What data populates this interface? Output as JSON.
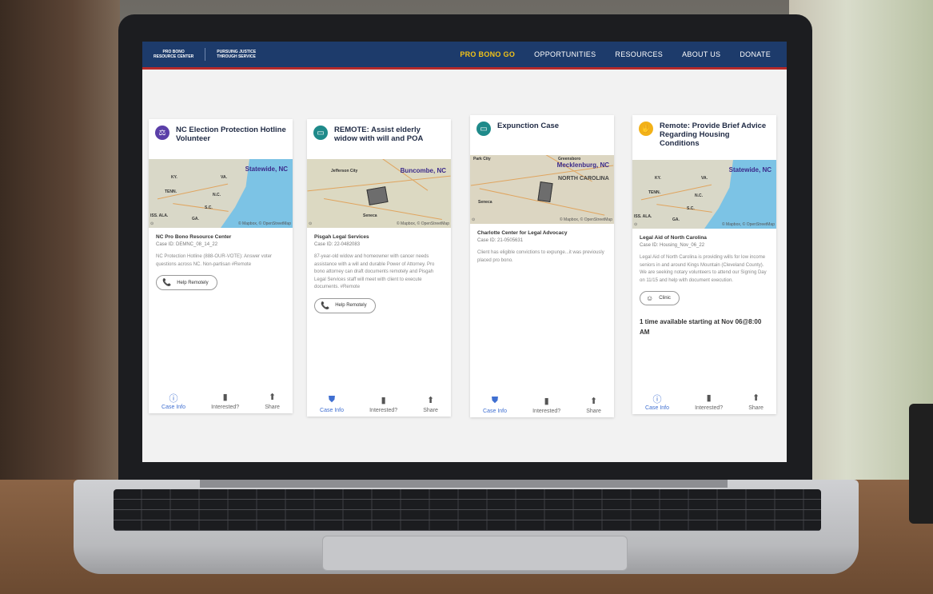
{
  "nav": {
    "brand_top": "PRO BONO",
    "brand_sub": "RESOURCE CENTER",
    "tagline": "PURSUING JUSTICE THROUGH SERVICE",
    "links": [
      "PRO BONO GO",
      "OPPORTUNITIES",
      "RESOURCES",
      "ABOUT US",
      "DONATE"
    ]
  },
  "colors": {
    "nav_bg": "#1d3b6b",
    "nav_accent": "#b52a2a",
    "active_link": "#f2c318",
    "link_blue": "#3f6fd1"
  },
  "map_attribution": "© Mapbox, © OpenStreetMap",
  "footer": {
    "case_info": "Case Info",
    "interested": "Interested?",
    "share": "Share"
  },
  "cards": [
    {
      "icon": "scales-icon",
      "icon_color": "#5b3fa8",
      "title": "NC Election Protection Hotline Volunteer",
      "map_label": "Statewide, NC",
      "org": "NC Pro Bono Resource Center",
      "case_id": "Case ID: DEMNC_08_14_22",
      "description": "NC Protection Hotline (888-OUR-VOTE): Answer voter questions across NC. Non-partisan #Remote",
      "pill": "Help Remotely"
    },
    {
      "icon": "chat-icon",
      "icon_color": "#1f8a8a",
      "title": "REMOTE: Assist elderly widow with will and POA",
      "map_label": "Buncombe, NC",
      "org": "Pisgah Legal Services",
      "case_id": "Case ID: 22-0482083",
      "description": "87-year-old widow and homeowner with cancer needs assistance with a will and durable Power of Attorney. Pro bono attorney can draft documents remotely and Pisgah Legal Services staff will meet with client to execute documents. #Remote",
      "pill": "Help Remotely"
    },
    {
      "icon": "chat-icon",
      "icon_color": "#1f8a8a",
      "title": "Expunction Case",
      "map_label": "Mecklenburg, NC",
      "map_region": "NORTH CAROLINA",
      "org": "Charlotte Center for Legal Advocacy",
      "case_id": "Case ID: 21-0505631",
      "description": "Client has eligible convictions to expunge...it was previously placed pro bono."
    },
    {
      "icon": "hand-icon",
      "icon_color": "#f2b118",
      "title": "Remote: Provide Brief Advice Regarding Housing Conditions",
      "map_label": "Statewide, NC",
      "org": "Legal Aid of North Carolina",
      "case_id": "Case ID: Housing_Nov_06_22",
      "description": "Legal Aid of North Carolina is providing wills for low income seniors in and around Kings Mountain (Cleveland County). We are seeking notary volunteers to attend our Signing Day on 11/15 and help with document execution.",
      "pill": "Clinic",
      "availability": "1 time available starting at Nov 06@8:00 AM"
    }
  ]
}
